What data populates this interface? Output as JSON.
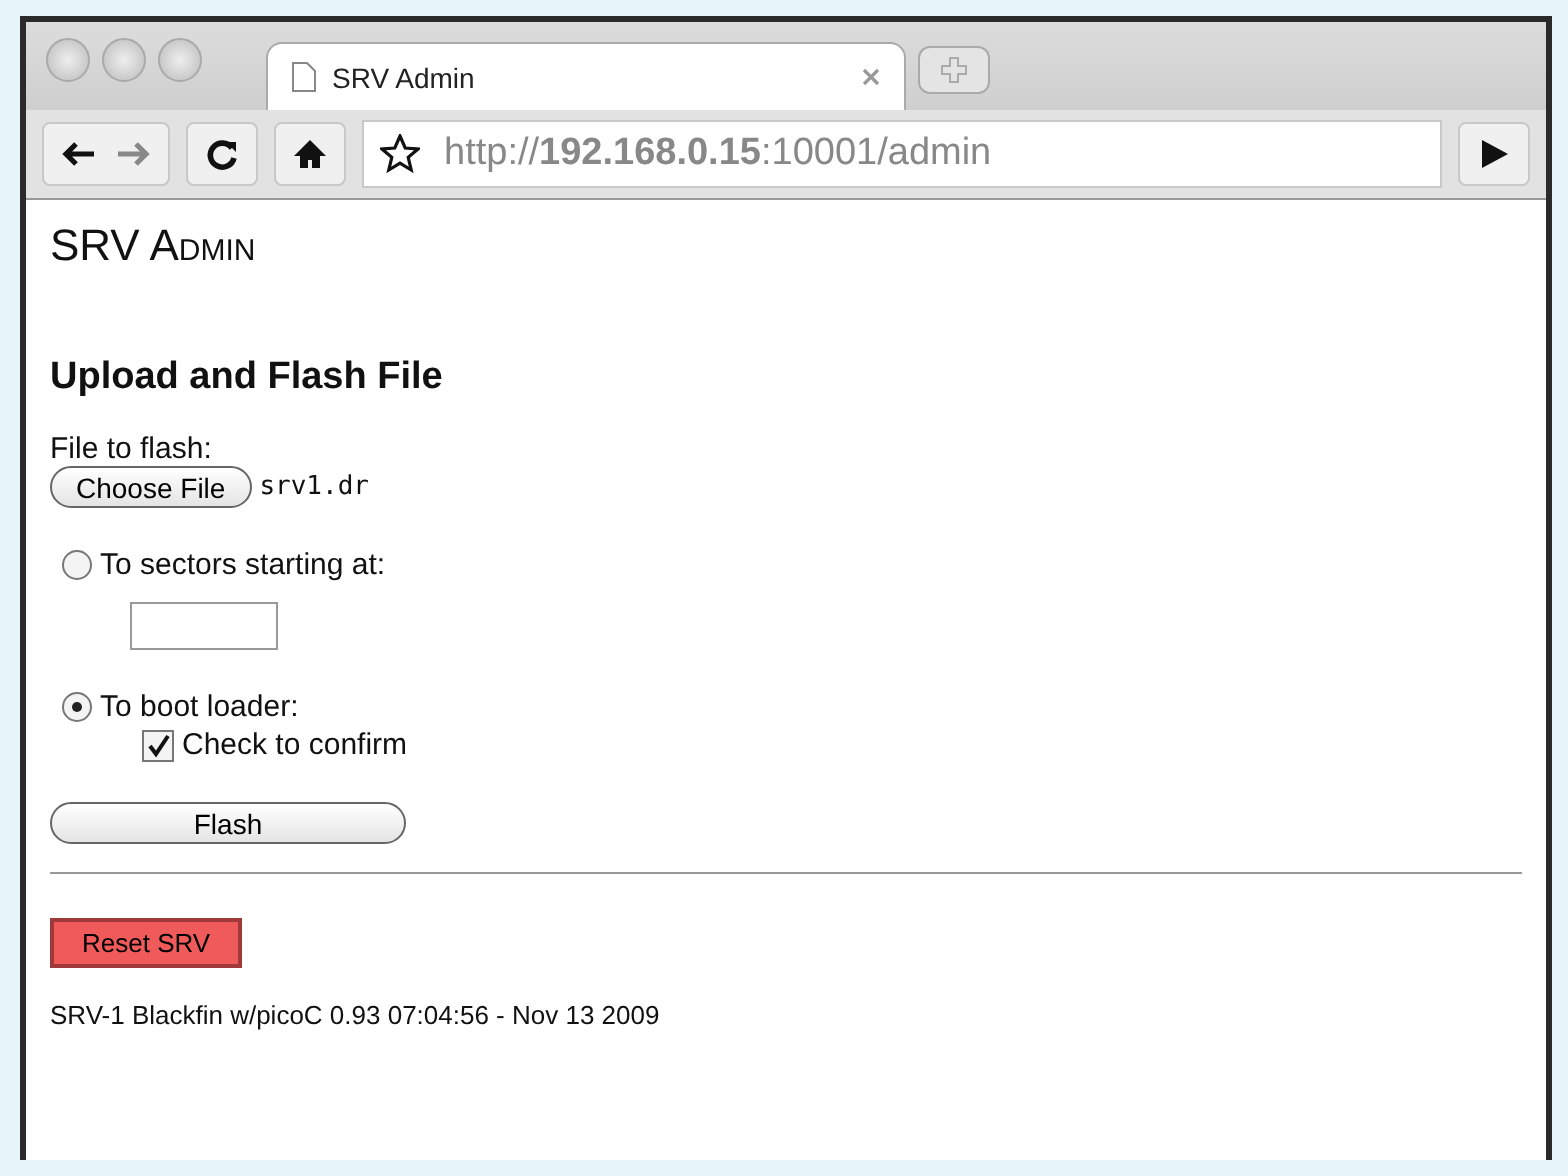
{
  "tabs": [
    {
      "title": "SRV Admin",
      "selected": true
    }
  ],
  "address_bar": {
    "url": "http://**192.168.0.15**:10001/admin"
  },
  "page": {
    "title": "SRV Admin",
    "heading": "Upload and Flash File",
    "file_label": "File to flash:",
    "choose_button": "Choose File",
    "file_name": "srv1.dr",
    "options": [
      {
        "label": "To sectors starting at:",
        "selected": false,
        "kind": "field"
      },
      {
        "label": "To boot loader:",
        "selected": true,
        "kind": "confirm",
        "confirm_label": "Check to confirm",
        "checked": true
      }
    ],
    "flash_button": "Flash",
    "reset_button": "Reset SRV",
    "footer": "SRV-1 Blackfin w/picoC 0.93 07:04:56 - Nov 13 2009"
  }
}
